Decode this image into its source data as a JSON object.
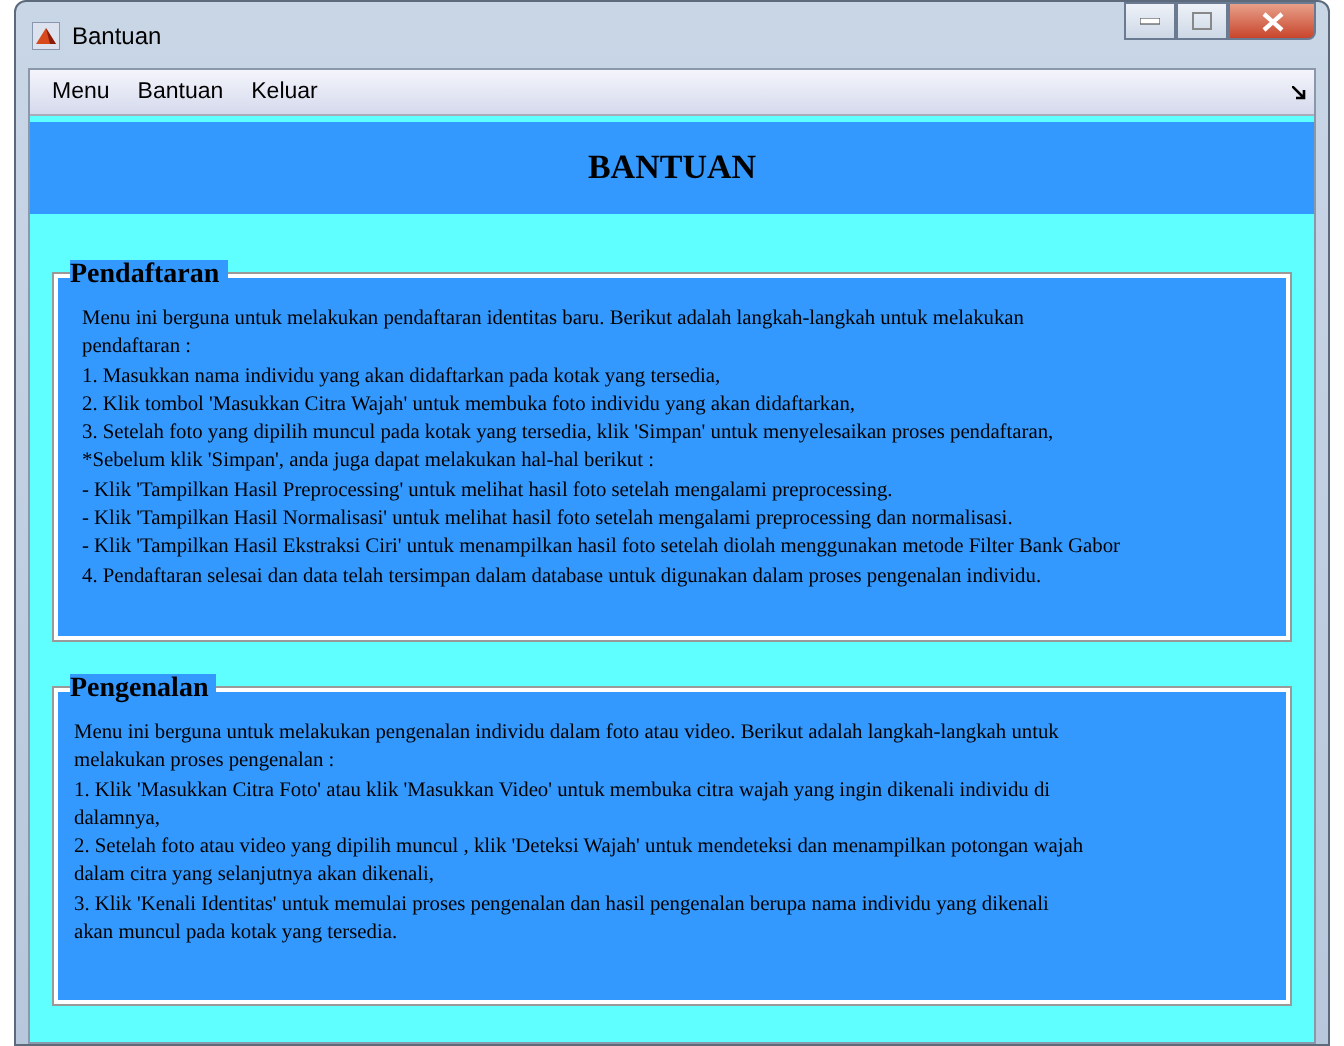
{
  "window": {
    "title": "Bantuan"
  },
  "menu": [
    "Menu",
    "Bantuan",
    "Keluar"
  ],
  "header": "BANTUAN",
  "panels": [
    {
      "title": "Pendaftaran",
      "lines": [
        "Menu ini berguna untuk melakukan pendaftaran identitas baru. Berikut adalah langkah-langkah untuk melakukan",
        "pendaftaran :",
        "1. Masukkan nama individu yang akan didaftarkan pada kotak yang tersedia,",
        "2. Klik tombol 'Masukkan Citra Wajah' untuk membuka foto individu yang akan didaftarkan,",
        "3. Setelah foto yang dipilih muncul pada kotak yang tersedia, klik 'Simpan' untuk menyelesaikan proses pendaftaran,",
        "*Sebelum klik 'Simpan', anda juga dapat melakukan hal-hal berikut :",
        "- Klik 'Tampilkan Hasil Preprocessing' untuk melihat hasil foto setelah mengalami preprocessing.",
        "- Klik 'Tampilkan Hasil Normalisasi' untuk melihat hasil foto setelah mengalami preprocessing dan normalisasi.",
        "- Klik 'Tampilkan Hasil Ekstraksi Ciri' untuk menampilkan hasil foto setelah diolah menggunakan metode Filter Bank Gabor",
        "4. Pendaftaran selesai dan data telah tersimpan dalam database untuk digunakan dalam proses pengenalan individu."
      ]
    },
    {
      "title": "Pengenalan",
      "lines": [
        "Menu ini berguna untuk melakukan pengenalan individu dalam foto atau video. Berikut adalah langkah-langkah untuk",
        "melakukan proses pengenalan  :",
        "1. Klik 'Masukkan Citra Foto' atau klik 'Masukkan Video' untuk membuka citra wajah yang ingin dikenali individu di",
        "dalamnya,",
        "2. Setelah foto atau video yang dipilih muncul , klik 'Deteksi Wajah' untuk mendeteksi dan menampilkan potongan wajah",
        "dalam citra yang selanjutnya akan dikenali,",
        "3. Klik 'Kenali Identitas' untuk memulai proses pengenalan dan hasil pengenalan berupa nama individu yang dikenali",
        "akan muncul pada kotak yang tersedia."
      ]
    }
  ]
}
